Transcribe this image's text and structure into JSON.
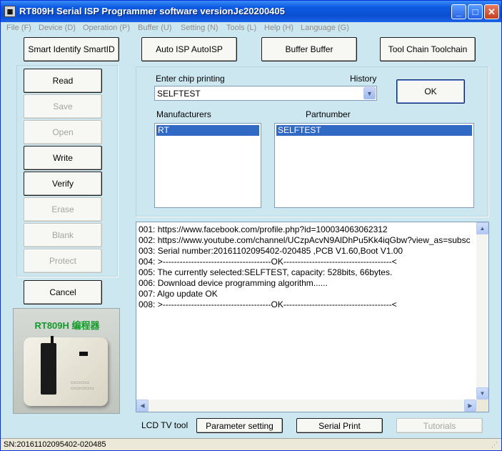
{
  "window": {
    "title": "RT809H Serial ISP Programmer software versionJє20200405",
    "icon": "app-icon",
    "minimize": "_",
    "maximize": "□",
    "close": "✕"
  },
  "menu": [
    {
      "label": "File (F)"
    },
    {
      "label": "Device (D)"
    },
    {
      "label": "Operation (P)"
    },
    {
      "label": "Buffer (U)"
    },
    {
      "label": "Setting (N)"
    },
    {
      "label": "Tools (L)"
    },
    {
      "label": "Help (H)"
    },
    {
      "label": "Language (G)"
    }
  ],
  "toolbar": {
    "smart_identify": "Smart Identify SmartID",
    "auto_isp": "Auto ISP AutoISP",
    "buffer": "Buffer Buffer",
    "tool_chain": "Tool Chain Toolchain"
  },
  "actions": {
    "read": "Read",
    "save": "Save",
    "open": "Open",
    "write": "Write",
    "verify": "Verify",
    "erase": "Erase",
    "blank": "Blank",
    "protect": "Protect",
    "cancel": "Cancel"
  },
  "chip": {
    "enter_label": "Enter chip printing",
    "history_label": "History",
    "value": "SELFTEST",
    "ok": "OK",
    "manufacturers_label": "Manufacturers",
    "partnumber_label": "Partnumber",
    "manufacturer_selected": "RT",
    "partnumber_selected": "SELFTEST"
  },
  "device_image": {
    "title": "RT809H 编程器"
  },
  "log": [
    "001:  https://www.facebook.com/profile.php?id=100034063062312",
    "002:  https://www.youtube.com/channel/UCzpAcvN9AlDhPu5Kk4iqGbw?view_as=subsc",
    "003:  Serial number:20161102095402-020485  ,PCB V1.60,Boot V1.00",
    "004:  >--------------------------------------OK--------------------------------------<",
    "005:  The currently selected:SELFTEST, capacity: 528bits, 66bytes.",
    "006:  Download device programming algorithm......",
    "007:  Algo update OK",
    "008:  >--------------------------------------OK--------------------------------------<"
  ],
  "bottom": {
    "lcd_label": "LCD TV tool",
    "parameter_setting": "Parameter setting",
    "serial_print": "Serial Print",
    "tutorials": "Tutorials"
  },
  "status": {
    "sn": "SN:20161102095402-020485"
  }
}
